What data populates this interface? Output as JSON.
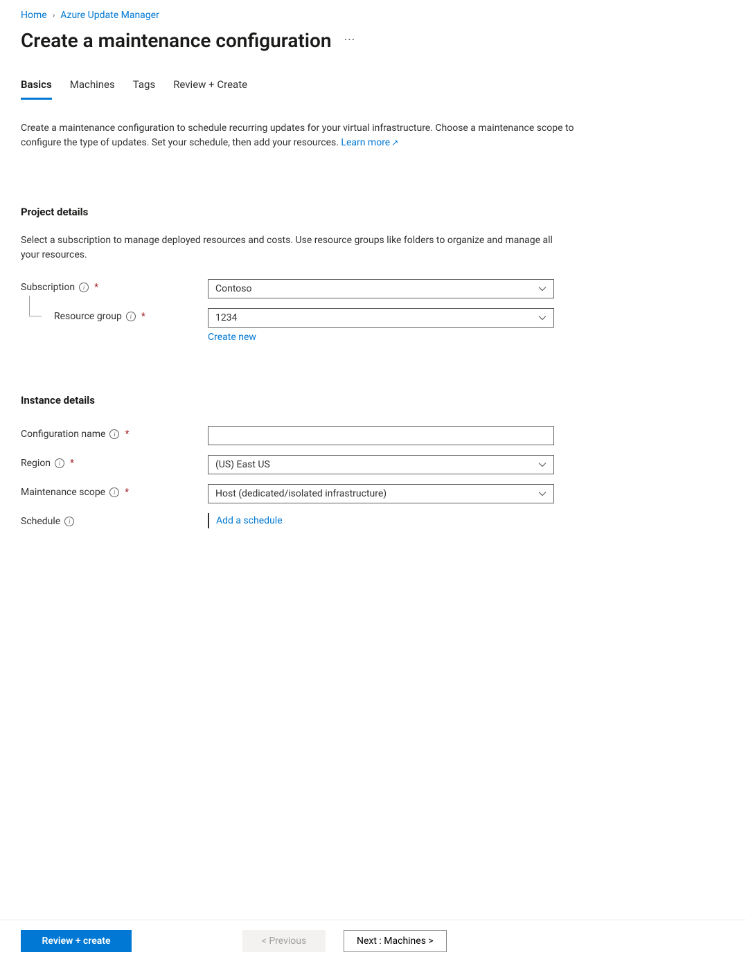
{
  "breadcrumb": {
    "home": "Home",
    "parent": "Azure Update Manager"
  },
  "page_title": "Create a maintenance configuration",
  "tabs": {
    "basics": "Basics",
    "machines": "Machines",
    "tags": "Tags",
    "review": "Review + Create"
  },
  "intro": {
    "text": "Create a maintenance configuration to schedule recurring updates for your virtual infrastructure. Choose a maintenance scope to configure the type of updates. Set your schedule, then add your resources. ",
    "learn_more": "Learn more"
  },
  "project": {
    "title": "Project details",
    "desc": "Select a subscription to manage deployed resources and costs. Use resource groups like folders to organize and manage all your resources.",
    "subscription_label": "Subscription",
    "subscription_value": "Contoso",
    "resource_group_label": "Resource group",
    "resource_group_value": "1234",
    "create_new": "Create new"
  },
  "instance": {
    "title": "Instance details",
    "config_name_label": "Configuration name",
    "config_name_value": "",
    "region_label": "Region",
    "region_value": "(US) East US",
    "scope_label": "Maintenance scope",
    "scope_value": "Host (dedicated/isolated infrastructure)",
    "schedule_label": "Schedule",
    "add_schedule": "Add a schedule"
  },
  "footer": {
    "review_create": "Review + create",
    "previous": "< Previous",
    "next": "Next : Machines >"
  }
}
